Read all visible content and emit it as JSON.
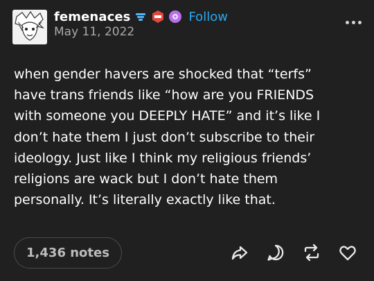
{
  "post": {
    "username": "femenaces",
    "follow_label": "Follow",
    "date": "May 11, 2022",
    "body": "when gender havers are shocked that “terfs”\nhave trans friends like “how are you FRIENDS\nwith someone you DEEPLY HATE” and it’s like I\ndon’t hate them I just don’t subscribe to their\nideology. Just like I think my religious friends’\nreligions are wack but I don’t hate them\npersonally. It’s literally exactly like that.",
    "notes_label": "1,436 notes"
  },
  "colors": {
    "background": "#202020",
    "follow": "#29a8f0",
    "muted": "#a9a9a9"
  },
  "icons": {
    "badges": [
      "blue-badge-icon",
      "red-hexagon-badge-icon",
      "purple-flower-badge-icon"
    ],
    "actions": [
      "share-icon",
      "reply-icon",
      "reblog-icon",
      "like-icon"
    ],
    "menu": "more-options-icon"
  }
}
